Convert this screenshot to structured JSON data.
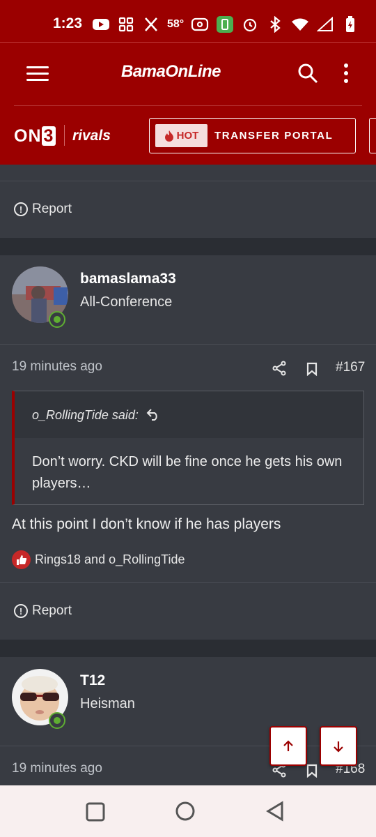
{
  "status_bar": {
    "time": "1:23",
    "temp": "58°"
  },
  "header": {
    "logo": "BamaOnLine",
    "on3": "ON3",
    "rivals": "rivals",
    "hot_label": "HOT",
    "transfer_portal_label": "TRANSFER PORTAL"
  },
  "posts": [
    {
      "report_label": "Report"
    },
    {
      "username": "bamaslama33",
      "user_title": "All-Conference",
      "time": "19 minutes ago",
      "number": "#167",
      "quote_attribution": "o_RollingTide said:",
      "quote_text": "Don’t worry. CKD will be fine once he gets his own players…",
      "body": "At this point I don’t know if he has players",
      "reactions": "Rings18 and o_RollingTide",
      "report_label": "Report"
    },
    {
      "username": "T12",
      "user_title": "Heisman",
      "time": "19 minutes ago",
      "number": "#168"
    }
  ],
  "colors": {
    "brand": "#9b0000",
    "online": "#5fae32",
    "background": "#2a2d33",
    "card": "#383b42"
  }
}
